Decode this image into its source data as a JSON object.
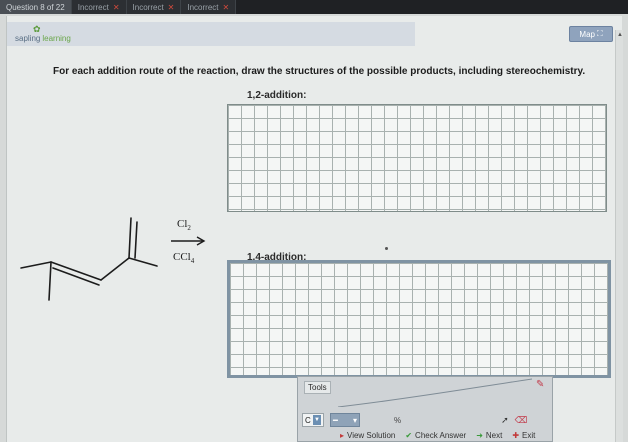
{
  "tabs": [
    {
      "label": "Question 8 of 22",
      "status_icon": ""
    },
    {
      "label": "Incorrect",
      "status_icon": "✕"
    },
    {
      "label": "Incorrect",
      "status_icon": "✕"
    },
    {
      "label": "Incorrect",
      "status_icon": "✕"
    }
  ],
  "header": {
    "logo_word1": "sapling",
    "logo_word2": "learning",
    "map_label": "Map"
  },
  "question": {
    "instructions": "For each addition route of the reaction, draw the structures of the possible products, including stereochemistry.",
    "label_12": "1,2-addition:",
    "label_14": "1,4-addition:"
  },
  "reaction": {
    "reagent_top": "Cl",
    "reagent_top_sub": "2",
    "reagent_bottom": "CCl",
    "reagent_bottom_sub": "4"
  },
  "tools": {
    "title": "Tools",
    "element": "C",
    "percent": "%"
  },
  "actions": {
    "view_solution": "View Solution",
    "check_answer": "Check Answer",
    "next": "Next",
    "exit": "Exit"
  },
  "colors": {
    "tab_bar": "#2c2f33",
    "panel_bg": "#e8ebea",
    "grid_line": "#a8b1af",
    "accent_blue": "#8fa3bd",
    "error_red": "#d04a3c"
  }
}
